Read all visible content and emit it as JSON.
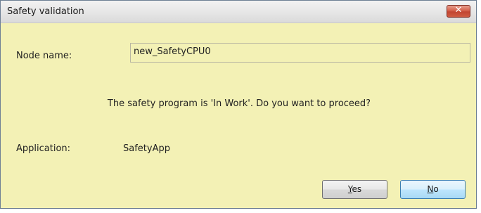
{
  "window": {
    "title": "Safety validation",
    "close_glyph": "✕"
  },
  "node": {
    "label": "Node name:",
    "value": "new_SafetyCPU0"
  },
  "message": "The safety program is 'In Work'. Do you want to proceed?",
  "application": {
    "label": "Application:",
    "value": "SafetyApp"
  },
  "buttons": {
    "yes_mnemonic": "Y",
    "yes_rest": "es",
    "no_mnemonic": "N",
    "no_rest": "o"
  },
  "colors": {
    "dialog_background": "#f3f1b5",
    "close_button": "#c24632",
    "default_button_border": "#3c7fb1"
  }
}
